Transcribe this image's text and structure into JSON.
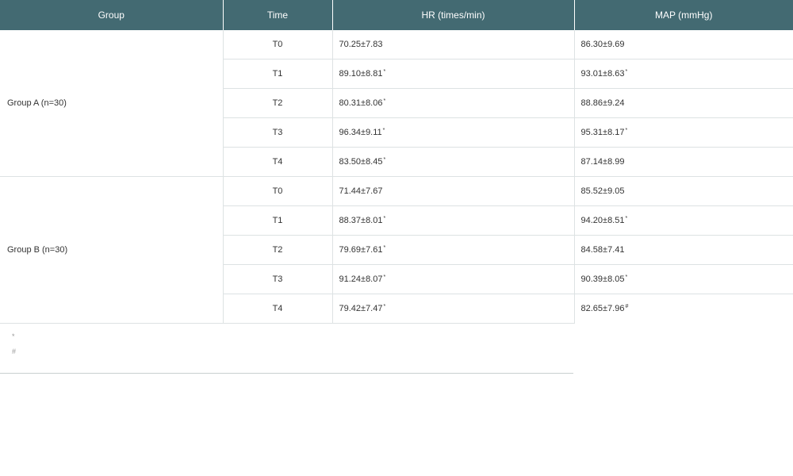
{
  "table": {
    "headers": {
      "group": "Group",
      "time": "Time",
      "hr": "HR (times/min)",
      "map": "MAP (mmHg)"
    },
    "groups": [
      {
        "label": "Group A (n=30)",
        "rows": [
          {
            "time": "T0",
            "hr": "70.25±7.83",
            "hr_mark": "",
            "map": "86.30±9.69",
            "map_mark": ""
          },
          {
            "time": "T1",
            "hr": "89.10±8.81",
            "hr_mark": "*",
            "map": "93.01±8.63",
            "map_mark": "*"
          },
          {
            "time": "T2",
            "hr": "80.31±8.06",
            "hr_mark": "*",
            "map": "88.86±9.24",
            "map_mark": ""
          },
          {
            "time": "T3",
            "hr": "96.34±9.11",
            "hr_mark": "*",
            "map": "95.31±8.17",
            "map_mark": "*"
          },
          {
            "time": "T4",
            "hr": "83.50±8.45",
            "hr_mark": "*",
            "map": "87.14±8.99",
            "map_mark": ""
          }
        ]
      },
      {
        "label": "Group B (n=30)",
        "rows": [
          {
            "time": "T0",
            "hr": "71.44±7.67",
            "hr_mark": "",
            "map": "85.52±9.05",
            "map_mark": ""
          },
          {
            "time": "T1",
            "hr": "88.37±8.01",
            "hr_mark": "*",
            "map": "94.20±8.51",
            "map_mark": "*"
          },
          {
            "time": "T2",
            "hr": "79.69±7.61",
            "hr_mark": "*",
            "map": "84.58±7.41",
            "map_mark": ""
          },
          {
            "time": "T3",
            "hr": "91.24±8.07",
            "hr_mark": "*",
            "map": "90.39±8.05",
            "map_mark": "*"
          },
          {
            "time": "T4",
            "hr": "79.42±7.47",
            "hr_mark": "*",
            "map": "82.65±7.96",
            "map_mark": "#"
          }
        ]
      }
    ]
  },
  "footnotes": [
    "*",
    "#"
  ]
}
